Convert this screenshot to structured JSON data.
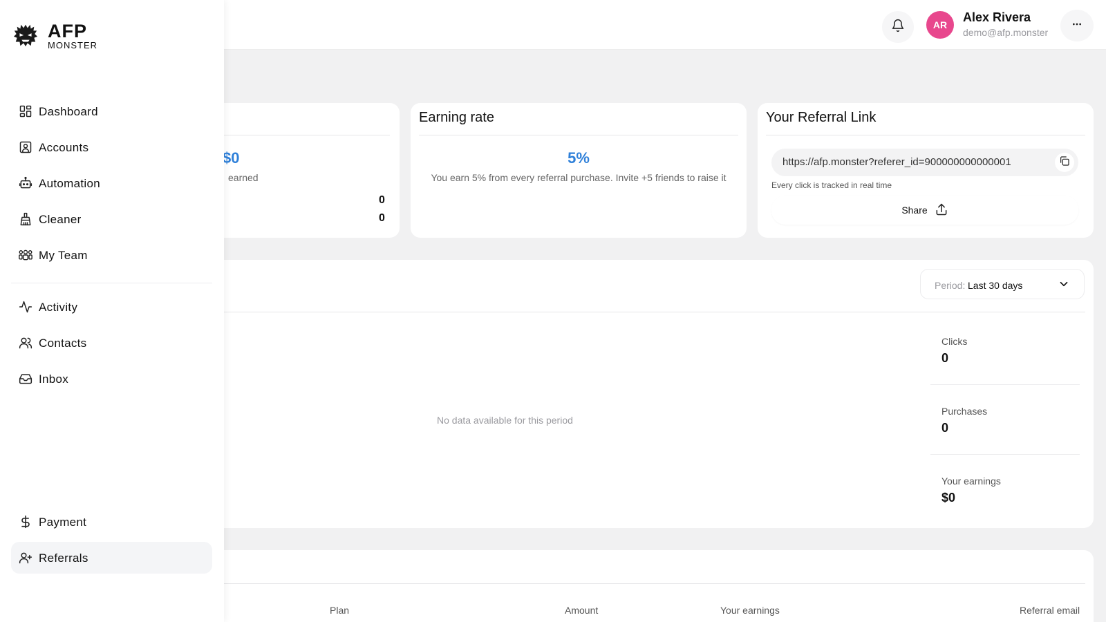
{
  "brand": {
    "name": "AFP",
    "sub": "MONSTER",
    "logo_icon": "monster-icon"
  },
  "user": {
    "initials": "AR",
    "name": "Alex Rivera",
    "email": "demo@afp.monster",
    "avatar_color": "#e8478d"
  },
  "sidebar": {
    "items": [
      {
        "label": "Dashboard",
        "icon": "dashboard-icon"
      },
      {
        "label": "Accounts",
        "icon": "accounts-icon"
      },
      {
        "label": "Automation",
        "icon": "automation-icon"
      },
      {
        "label": "Cleaner",
        "icon": "cleaner-icon"
      },
      {
        "label": "My Team",
        "icon": "team-icon"
      },
      {
        "label": "Activity",
        "icon": "activity-icon"
      },
      {
        "label": "Contacts",
        "icon": "contacts-icon"
      },
      {
        "label": "Inbox",
        "icon": "inbox-icon"
      },
      {
        "label": "Payment",
        "icon": "dollar-icon"
      },
      {
        "label": "Referrals",
        "icon": "user-plus-icon",
        "active": true
      }
    ]
  },
  "earnings_card": {
    "amount": "$0",
    "amount_caption": "earned",
    "row1_value": "0",
    "row2_value": "0"
  },
  "earning_rate_card": {
    "title": "Earning rate",
    "rate": "5%",
    "description": "You earn 5% from every referral purchase. Invite +5 friends to raise it"
  },
  "referral_card": {
    "title": "Your Referral Link",
    "link": "https://afp.monster?referer_id=900000000000001",
    "note": "Every click is tracked in real time",
    "share_label": "Share"
  },
  "stats_panel": {
    "period_label": "Period:",
    "period_value": "Last 30 days",
    "no_data": "No data available for this period",
    "stats": [
      {
        "label": "Clicks",
        "value": "0"
      },
      {
        "label": "Purchases",
        "value": "0"
      },
      {
        "label": "Your earnings",
        "value": "$0"
      }
    ]
  },
  "table": {
    "headers": [
      "Plan",
      "Amount",
      "Your earnings",
      "Referral email"
    ]
  },
  "colors": {
    "accent_blue": "#2f80d9",
    "page_bg": "#f1f1f2"
  }
}
